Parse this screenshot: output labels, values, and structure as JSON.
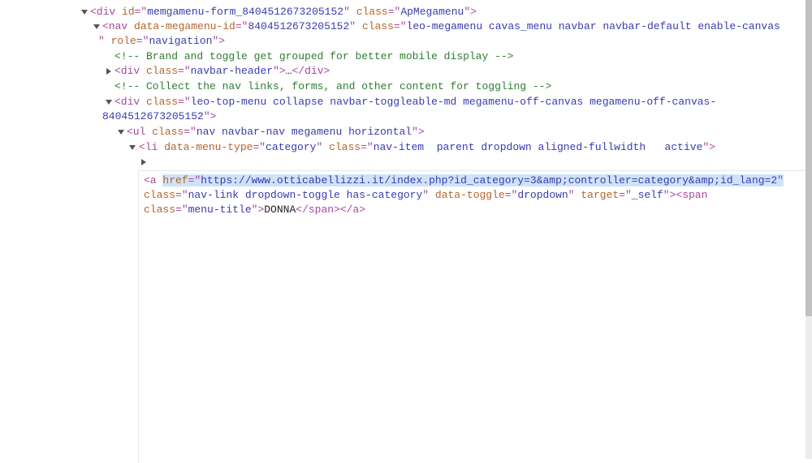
{
  "dom_tree": [
    {
      "tokens": [
        [
          "tag",
          "<div "
        ],
        [
          "an",
          "id"
        ],
        [
          "tag",
          "=\""
        ],
        [
          "av",
          "memgamenu-form_8404512673205152"
        ],
        [
          "tag",
          "\" "
        ],
        [
          "an",
          "class"
        ],
        [
          "tag",
          "=\""
        ],
        [
          "av",
          "ApMegamenu"
        ],
        [
          "tag",
          "\">"
        ]
      ]
    },
    {
      "tokens": [
        [
          "tag",
          "<nav "
        ],
        [
          "an",
          "data-megamenu-id"
        ],
        [
          "tag",
          "=\""
        ],
        [
          "av",
          "8404512673205152"
        ],
        [
          "tag",
          "\" "
        ],
        [
          "an",
          "class"
        ],
        [
          "tag",
          "=\""
        ],
        [
          "av",
          "leo-megamenu cavas_menu navbar navbar-default enable-canvas"
        ]
      ]
    },
    {
      "tokens": [
        [
          "tag",
          "\" "
        ],
        [
          "an",
          "role"
        ],
        [
          "tag",
          "=\""
        ],
        [
          "av",
          "navigation"
        ],
        [
          "tag",
          "\">"
        ]
      ]
    },
    {
      "tokens": [
        [
          "cm",
          "<!-- Brand and toggle get grouped for better mobile display -->"
        ]
      ]
    },
    {
      "tokens": [
        [
          "tag",
          "<div "
        ],
        [
          "an",
          "class"
        ],
        [
          "tag",
          "=\""
        ],
        [
          "av",
          "navbar-header"
        ],
        [
          "tag",
          "\">"
        ],
        [
          "tx",
          "…"
        ],
        [
          "tag",
          "</div>"
        ]
      ]
    },
    {
      "tokens": [
        [
          "cm",
          "<!-- Collect the nav links, forms, and other content for toggling -->"
        ]
      ]
    },
    {
      "tokens": [
        [
          "tag",
          "<div "
        ],
        [
          "an",
          "class"
        ],
        [
          "tag",
          "=\""
        ],
        [
          "av",
          "leo-top-menu collapse navbar-toggleable-md megamenu-off-canvas megamenu-off-canvas-"
        ]
      ]
    },
    {
      "tokens": [
        [
          "av",
          "8404512673205152"
        ],
        [
          "tag",
          "\">"
        ]
      ]
    },
    {
      "tokens": [
        [
          "tag",
          "<ul "
        ],
        [
          "an",
          "class"
        ],
        [
          "tag",
          "=\""
        ],
        [
          "av",
          "nav navbar-nav megamenu horizontal"
        ],
        [
          "tag",
          "\">"
        ]
      ]
    },
    {
      "tokens": [
        [
          "tag",
          "<li "
        ],
        [
          "an",
          "data-menu-type"
        ],
        [
          "tag",
          "=\""
        ],
        [
          "av",
          "category"
        ],
        [
          "tag",
          "\" "
        ],
        [
          "an",
          "class"
        ],
        [
          "tag",
          "=\""
        ],
        [
          "av",
          "nav-item  parent dropdown aligned-fullwidth   active"
        ],
        [
          "tag",
          "\">"
        ]
      ]
    }
  ],
  "editor": [
    {
      "tokens": [
        [
          "tag",
          "<a "
        ],
        [
          "an hl",
          "href"
        ],
        [
          "tag hl",
          "=\""
        ],
        [
          "av hl",
          "https://www.otticabellizzi.it/index.php?id_category=3&amp;controller=category&amp;id_lang=2"
        ],
        [
          "tag hl",
          "\""
        ]
      ]
    },
    {
      "tokens": [
        [
          "an",
          "class"
        ],
        [
          "tag",
          "=\""
        ],
        [
          "av",
          "nav-link dropdown-toggle has-category"
        ],
        [
          "tag",
          "\" "
        ],
        [
          "an",
          "data-toggle"
        ],
        [
          "tag",
          "=\""
        ],
        [
          "av",
          "dropdown"
        ],
        [
          "tag",
          "\" "
        ],
        [
          "an",
          "target"
        ],
        [
          "tag",
          "=\""
        ],
        [
          "av",
          "_self"
        ],
        [
          "tag",
          "\"><span"
        ]
      ]
    },
    {
      "tokens": [
        [
          "an",
          "class"
        ],
        [
          "tag",
          "=\""
        ],
        [
          "av",
          "menu-title"
        ],
        [
          "tag",
          "\">"
        ],
        [
          "tx",
          "DONNA"
        ],
        [
          "tag",
          "</span></a>"
        ]
      ]
    }
  ]
}
